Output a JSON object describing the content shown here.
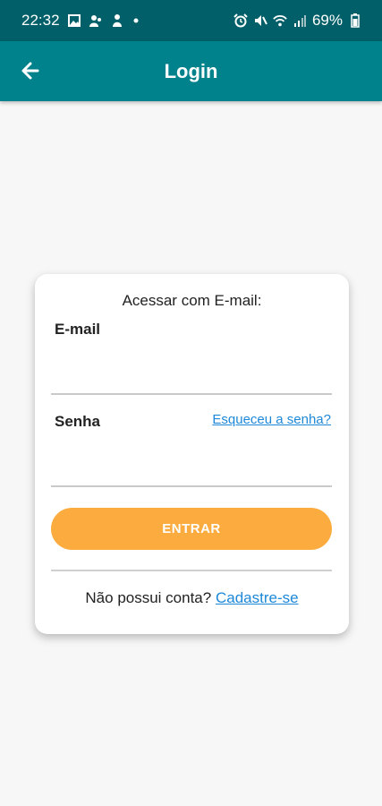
{
  "status_bar": {
    "time": "22:32",
    "battery": "69%",
    "left_icons": [
      "image-icon",
      "app-icon",
      "app-icon",
      "dot-icon"
    ],
    "right_icons": [
      "alarm-icon",
      "mute-icon",
      "wifi-icon",
      "signal-icon",
      "battery-icon"
    ]
  },
  "app_bar": {
    "title": "Login",
    "back_icon": "arrow-left-icon",
    "color": "#00828c"
  },
  "login_card": {
    "heading": "Acessar com E-mail:",
    "email_label": "E-mail",
    "email_value": "",
    "password_label": "Senha",
    "password_value": "",
    "forgot_link": "Esqueceu a senha?",
    "submit_label": "ENTRAR",
    "submit_color": "#fcac3e",
    "signup_prompt": "Não possui conta?",
    "signup_link": "Cadastre-se",
    "link_color": "#1e88d8"
  }
}
